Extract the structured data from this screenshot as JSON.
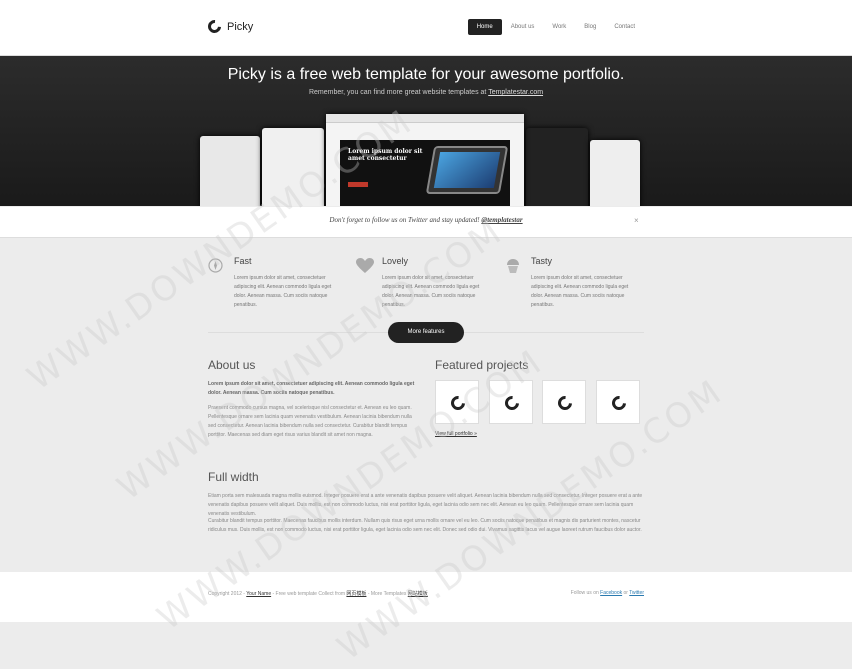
{
  "header": {
    "logo_text": "Picky",
    "nav": [
      {
        "label": "Home",
        "active": true
      },
      {
        "label": "About us",
        "active": false
      },
      {
        "label": "Work",
        "active": false
      },
      {
        "label": "Blog",
        "active": false
      },
      {
        "label": "Contact",
        "active": false
      }
    ]
  },
  "hero": {
    "title": "Picky is a free web template for your awesome portfolio.",
    "subtitle_prefix": "Remember, you can find more great website templates at ",
    "subtitle_link": "Templatestar.com",
    "screen_banner_text": "Lorem ipsum dolor sit amet consectetur"
  },
  "notice": {
    "text": "Don't forget to follow us on Twitter and stay updated! ",
    "handle": "@templatestar",
    "close": "×"
  },
  "features": [
    {
      "title": "Fast",
      "icon": "compass-icon",
      "text": "Lorem ipsum dolor sit amet, consectetuer adipiscing elit. Aenean commodo ligula eget dolor. Aenean massa. Cum sociis natoque penatibus."
    },
    {
      "title": "Lovely",
      "icon": "heart-icon",
      "text": "Lorem ipsum dolor sit amet, consectetuer adipiscing elit. Aenean commodo ligula eget dolor. Aenean massa. Cum sociis natoque penatibus."
    },
    {
      "title": "Tasty",
      "icon": "cupcake-icon",
      "text": "Lorem ipsum dolor sit amet, consectetuer adipiscing elit. Aenean commodo ligula eget dolor. Aenean massa. Cum sociis natoque penatibus."
    }
  ],
  "more_features": "More features",
  "about": {
    "title": "About us",
    "lead": "Lorem ipsum dolor sit amet, consectetuer adipiscing elit. Aenean commodo ligula eget dolor. Aenean massa. Cum sociis natoque penatibus.",
    "body": "Praesent commodo cursus magna, vel scelerisque nisl consectetur et. Aenean eu leo quam. Pellentesque ornare sem lacinia quam venenatis vestibulum. Aenean lacinia bibendum nulla sed consectetur. Aenean lacinia bibendum nulla sed consectetur. Curabitur blandit tempus porttitor. Maecenas sed diam eget risus varius blandit sit amet non magna."
  },
  "projects": {
    "title": "Featured projects",
    "view_link": "View full portfolio »"
  },
  "full_width": {
    "title": "Full width",
    "p1": "Etiam porta sem malesuada magna mollis euismod. Integer posuere erat a ante venenatis dapibus posuere velit aliquet. Aenean lacinia bibendum nulla sed consectetur. Integer posuere erat a ante venenatis dapibus posuere velit aliquet. Duis mollis, est non commodo luctus, nisi erat porttitor ligula, eget lacinia odio sem nec elit. Aenean eu leo quam. Pellentesque ornare sem lacinia quam venenatis vestibulum.",
    "p2": "Curabitur blandit tempus porttitor. Maecenas faucibus mollis interdum. Nullam quis risus eget urna mollis ornare vel eu leo. Cum sociis natoque penatibus et magnis dis parturient montes, nascetur ridiculus mus. Duis mollis, est non commodo luctus, nisi erat porttitor ligula, eget lacinia odio sem nec elit. Donec sed odio dui. Vivamus sagittis lacus vel augue laoreet rutrum faucibus dolor auctor."
  },
  "footer": {
    "copy_prefix": "Copyright 2012 - ",
    "your_name": "Your Name",
    "copy_mid": " - Free web template Collect from ",
    "link1": "网页模板",
    "copy_mid2": " - More Templates ",
    "link2": "网站模板",
    "follow_prefix": "Follow us on ",
    "facebook": "Facebook",
    "or": " or ",
    "twitter": "Twitter"
  },
  "watermark": "WWW.DOWNDEMO.COM"
}
